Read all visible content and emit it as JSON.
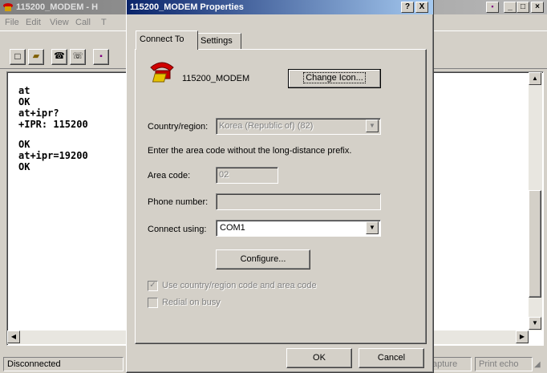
{
  "app": {
    "title": "115200_MODEM - H",
    "menu": [
      "File",
      "Edit",
      "View",
      "Call",
      "T"
    ],
    "terminal_lines": [
      "at",
      "OK",
      "at+ipr?",
      "+IPR: 115200",
      "",
      "OK",
      "at+ipr=19200",
      "OK"
    ],
    "status": {
      "connection": "Disconnected",
      "capture": "apture",
      "print_echo": "Print echo"
    }
  },
  "dialog": {
    "title": "115200_MODEM Properties",
    "help_btn": "?",
    "close_btn": "X",
    "tabs": [
      "Connect To",
      "Settings"
    ],
    "modem_name": "115200_MODEM",
    "change_icon_btn": "Change Icon...",
    "country_label": "Country/region:",
    "country_value": "Korea (Republic of) (82)",
    "area_prompt": "Enter the area code without the long-distance prefix.",
    "area_label": "Area code:",
    "area_value": "02",
    "phone_label": "Phone number:",
    "phone_value": "",
    "connect_label": "Connect using:",
    "connect_value": "COM1",
    "configure_btn": "Configure...",
    "use_country_label": "Use country/region code and area code",
    "redial_label": "Redial on busy",
    "ok_btn": "OK",
    "cancel_btn": "Cancel"
  },
  "colors": {
    "title_active": "#0a246a",
    "face": "#d4d0c8"
  }
}
